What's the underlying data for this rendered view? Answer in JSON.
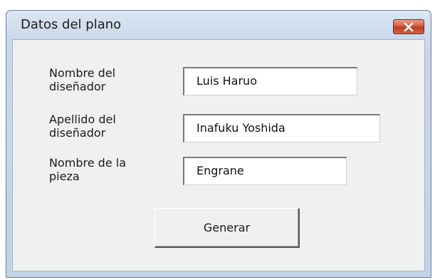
{
  "window": {
    "title": "Datos del plano",
    "close_icon": "close-icon"
  },
  "form": {
    "fields": [
      {
        "label": "Nombre del\ndiseñador",
        "value": "Luis Haruo"
      },
      {
        "label": "Apellido del\ndiseñador",
        "value": "Inafuku Yoshida"
      },
      {
        "label": "Nombre de la\npieza",
        "value": "Engrane"
      }
    ],
    "generate_label": "Generar"
  },
  "colors": {
    "titlebar": "#c9d8ea",
    "close_button": "#c8452b",
    "client_bg": "#f0f0f0"
  }
}
